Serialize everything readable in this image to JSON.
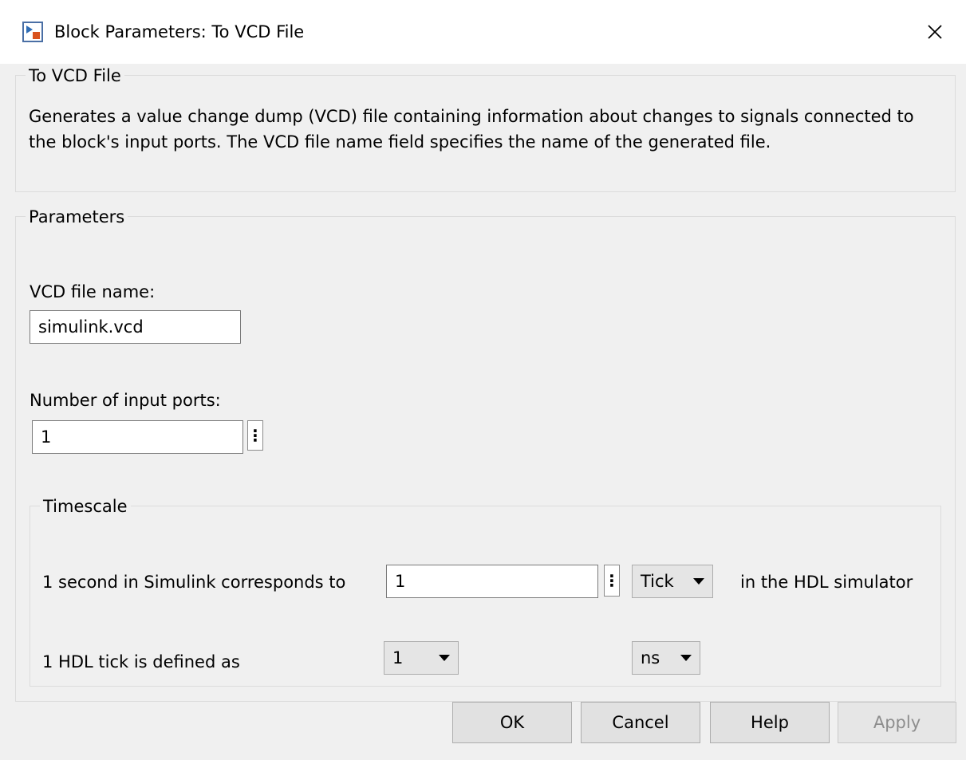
{
  "window": {
    "title": "Block Parameters: To VCD File",
    "icon": "simulink-block-icon",
    "close_icon": "close-icon"
  },
  "block_section": {
    "legend": "To VCD File",
    "description": "Generates a value change dump (VCD) file containing information about changes to signals connected to the block's input ports. The VCD file name field specifies the name of the generated file."
  },
  "parameters_section": {
    "legend": "Parameters",
    "vcd_file_name": {
      "label": "VCD file name:",
      "value": "simulink.vcd"
    },
    "input_ports": {
      "label": "Number of input ports:",
      "value": "1",
      "more_icon": "vertical-ellipsis-icon"
    },
    "timescale": {
      "legend": "Timescale",
      "row1": {
        "prefix": "1 second in Simulink corresponds to",
        "value": "1",
        "unit_selected": "Tick",
        "suffix": "in the HDL simulator"
      },
      "row2": {
        "prefix": "1 HDL tick is defined as",
        "multiplier_selected": "1",
        "unit_selected": "ns"
      }
    }
  },
  "buttons": {
    "ok": "OK",
    "cancel": "Cancel",
    "help": "Help",
    "apply": "Apply"
  }
}
